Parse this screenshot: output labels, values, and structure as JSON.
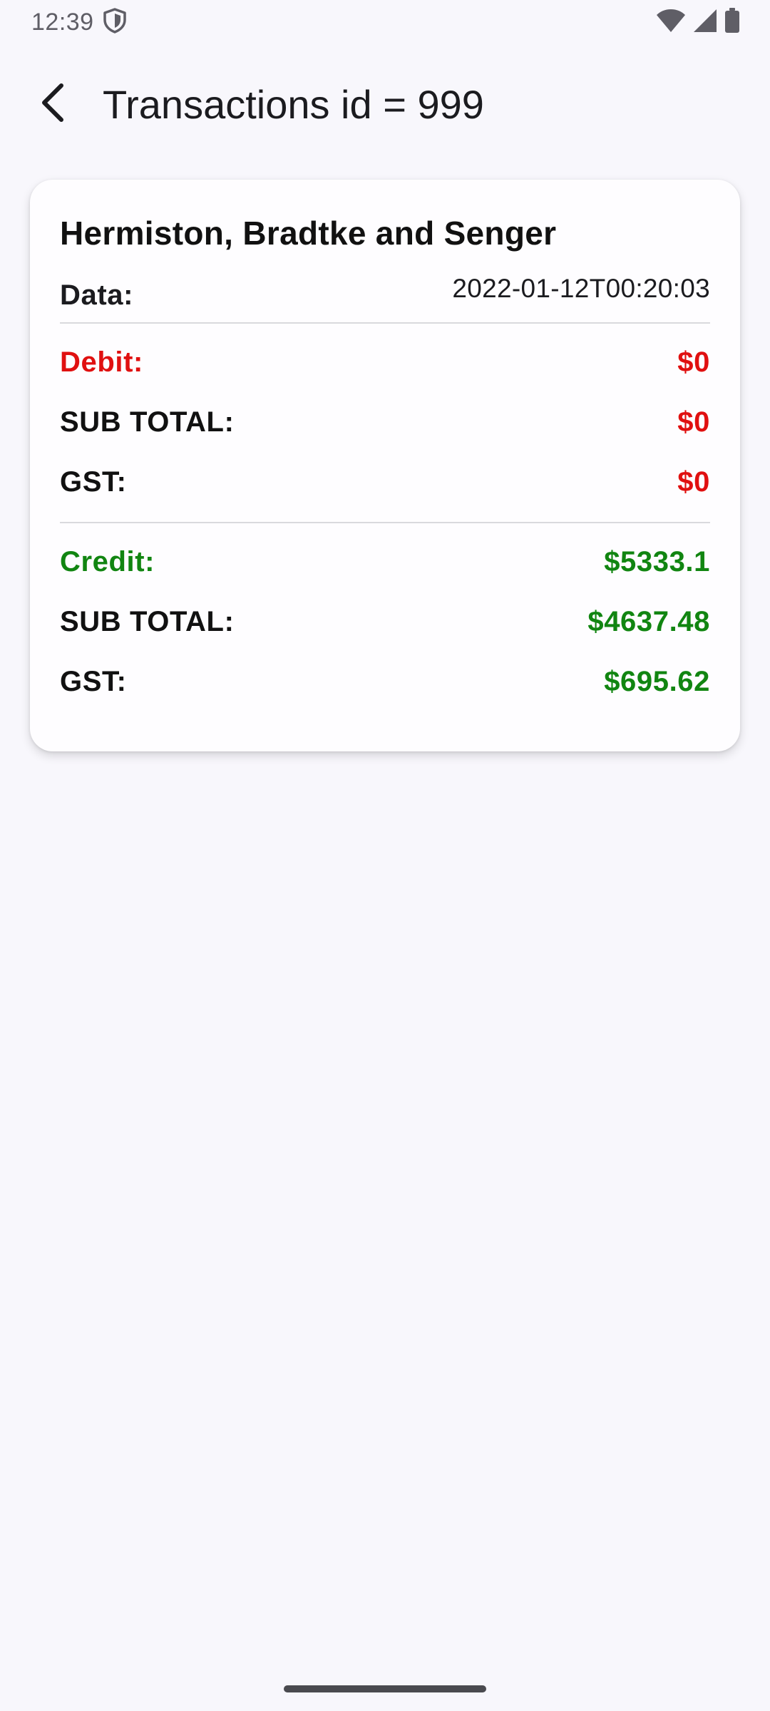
{
  "status_bar": {
    "time": "12:39",
    "icons": [
      "shield-icon",
      "wifi-icon",
      "signal-icon",
      "battery-icon"
    ]
  },
  "app_bar": {
    "back_icon": "arrow-back-icon",
    "title": "Transactions id = 999"
  },
  "card": {
    "company": "Hermiston, Bradtke and Senger",
    "date_label": "Data:",
    "date_value": "2022-01-12T00:20:03",
    "debit": {
      "label": "Debit:",
      "value": "$0",
      "sub_total_label": "SUB TOTAL:",
      "sub_total_value": "$0",
      "gst_label": "GST:",
      "gst_value": "$0"
    },
    "credit": {
      "label": "Credit:",
      "value": "$5333.1",
      "sub_total_label": "SUB TOTAL:",
      "sub_total_value": "$4637.48",
      "gst_label": "GST:",
      "gst_value": "$695.62"
    }
  },
  "colors": {
    "debit": "#e01010",
    "credit": "#118511",
    "background": "#f8f7fc",
    "card": "#fefdff"
  }
}
